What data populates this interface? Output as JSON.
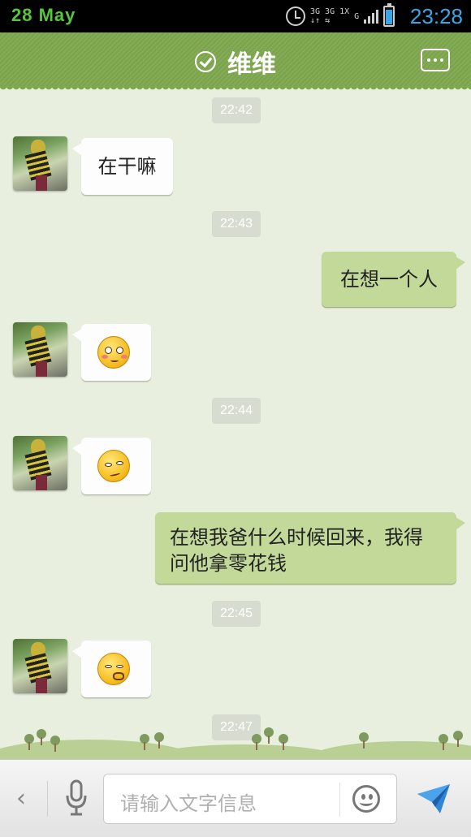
{
  "status_bar": {
    "date": "28 May",
    "network_left": "3G\n↓↑",
    "network_mid": "3G 1X\n⇆",
    "network_right": "G",
    "time": "23:28",
    "icons": [
      "alarm-icon",
      "signal-icon",
      "battery-icon"
    ],
    "time_color": "#39a8e8",
    "date_color": "#58c63c"
  },
  "header": {
    "title": "维维",
    "icons": [
      "verified-check-icon",
      "more-menu-icon"
    ],
    "bar_color": "#7fa84e"
  },
  "messages": [
    {
      "type": "time",
      "text": "22:42"
    },
    {
      "type": "in",
      "text": "在干嘛"
    },
    {
      "type": "time",
      "text": "22:43"
    },
    {
      "type": "out",
      "text": "在想一个人"
    },
    {
      "type": "in",
      "emoji": "blushing-face-emoji"
    },
    {
      "type": "time",
      "text": "22:44"
    },
    {
      "type": "in",
      "emoji": "smirking-face-emoji"
    },
    {
      "type": "out",
      "text": "在想我爸什么时候回来，我得问他拿零花钱"
    },
    {
      "type": "time",
      "text": "22:45"
    },
    {
      "type": "in",
      "emoji": "thinking-face-emoji"
    },
    {
      "type": "time",
      "text": "22:47"
    }
  ],
  "colors": {
    "chat_background": "#e8efdf",
    "incoming_bubble": "#fdfdfd",
    "outgoing_bubble": "#c2d99a"
  },
  "input_bar": {
    "back_label": "‹",
    "placeholder": "请输入文字信息",
    "icons": [
      "back-chevron-icon",
      "microphone-icon",
      "emoji-smile-icon",
      "send-paper-plane-icon"
    ]
  }
}
